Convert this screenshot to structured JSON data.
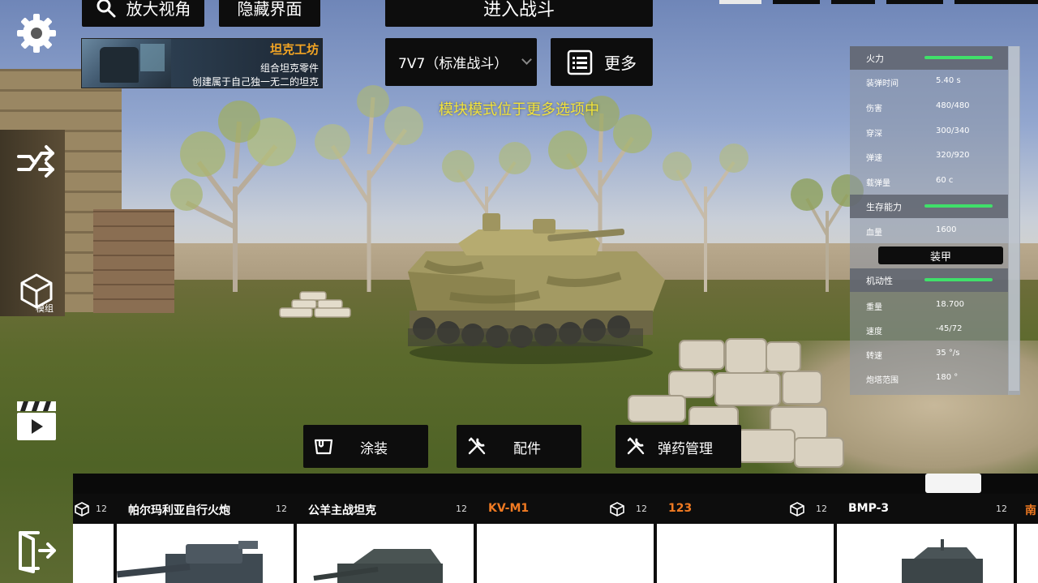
{
  "top_buttons": {
    "zoom_view": "放大视角",
    "hide_ui": "隐藏界面",
    "enter_battle": "进入战斗"
  },
  "workshop": {
    "title": "坦克工坊",
    "line1": "组合坦克零件",
    "line2": "创建属于自己独一无二的坦克"
  },
  "mode_select": {
    "value": "7V7（标准战斗）"
  },
  "more_button": {
    "label": "更多"
  },
  "hint": "模块模式位于更多选项中",
  "left_rail": {
    "module_label": "模组"
  },
  "stats": {
    "firepower": {
      "title": "火力",
      "rows": [
        {
          "label": "装弹时间",
          "value": "5.40 s"
        },
        {
          "label": "伤害",
          "value": "480/480"
        },
        {
          "label": "穿深",
          "value": "300/340"
        },
        {
          "label": "弹速",
          "value": "320/920"
        },
        {
          "label": "载弹量",
          "value": "60 c"
        }
      ]
    },
    "survivability": {
      "title": "生存能力",
      "rows": [
        {
          "label": "血量",
          "value": "1600"
        }
      ],
      "armor_button": "装甲"
    },
    "mobility": {
      "title": "机动性",
      "rows": [
        {
          "label": "重量",
          "value": "18.700"
        },
        {
          "label": "速度",
          "value": "-45/72"
        },
        {
          "label": "转速",
          "value": "35 °/s"
        },
        {
          "label": "炮塔范围",
          "value": "180 °"
        }
      ]
    },
    "bar_color": "#40e06a"
  },
  "actions": {
    "paint": "涂装",
    "parts": "配件",
    "ammo": "弹药管理"
  },
  "vehicles": [
    {
      "name": "",
      "count": "12",
      "module_icon": true
    },
    {
      "name": "帕尔玛利亚自行火炮",
      "count": "12",
      "module_icon": false,
      "name_color": "white"
    },
    {
      "name": "公羊主战坦克",
      "count": "12",
      "module_icon": false,
      "name_color": "white"
    },
    {
      "name": "KV-M1",
      "count": "12",
      "module_icon": true,
      "name_color": "orange"
    },
    {
      "name": "123",
      "count": "12",
      "module_icon": true,
      "name_color": "orange"
    },
    {
      "name": "BMP-3",
      "count": "12",
      "module_icon": false,
      "name_color": "white"
    },
    {
      "name": "南",
      "count": "",
      "module_icon": false,
      "name_color": "orange"
    }
  ],
  "colors": {
    "accent_orange": "#f07a22",
    "hint_yellow": "#f2e33a",
    "panel_dark": "#0d0d0d"
  }
}
